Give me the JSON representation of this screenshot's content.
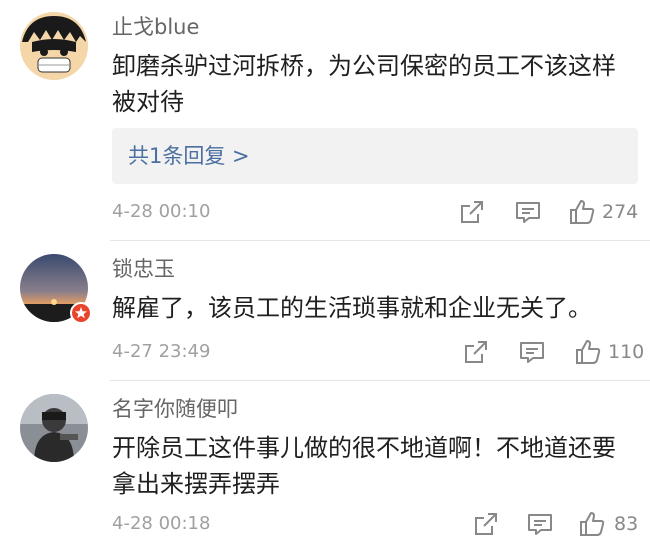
{
  "comments": [
    {
      "username": "止戈blue",
      "text": "卸磨杀驴过河拆桥，为公司保密的员工不该这样被对待",
      "reply_link": "共1条回复 >",
      "time": "4-28 00:10",
      "likes": "274",
      "avatar_icon": "cartoon-face-avatar"
    },
    {
      "username": "锁忠玉",
      "text": "解雇了，该员工的生活琐事就和企业无关了。",
      "time": "4-27 23:49",
      "likes": "110",
      "avatar_icon": "sunset-avatar",
      "badge_icon": "red-star-badge-icon"
    },
    {
      "username": "名字你随便叩",
      "text": "开除员工这件事儿做的很不地道啊！不地道还要拿出来摆弄摆弄",
      "time": "4-28 00:18",
      "likes": "83",
      "avatar_icon": "photo-avatar"
    }
  ],
  "colors": {
    "link": "#4a6fa0",
    "meta": "#a0a0a0",
    "badge": "#e8452c"
  }
}
